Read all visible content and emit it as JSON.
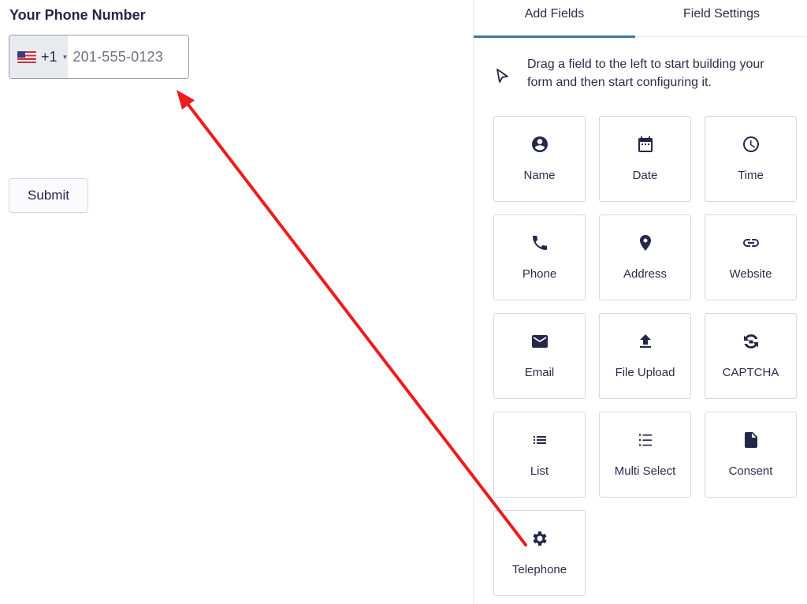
{
  "form": {
    "field_label": "Your Phone Number",
    "country_code": "+1",
    "phone_placeholder": "201-555-0123",
    "submit_label": "Submit"
  },
  "panel": {
    "tabs": [
      {
        "label": "Add Fields",
        "active": true
      },
      {
        "label": "Field Settings",
        "active": false
      }
    ],
    "hint": "Drag a field to the left to start building your form and then start configuring it.",
    "fields": [
      {
        "label": "Name",
        "icon": "account-circle-icon"
      },
      {
        "label": "Date",
        "icon": "calendar-icon"
      },
      {
        "label": "Time",
        "icon": "clock-icon"
      },
      {
        "label": "Phone",
        "icon": "phone-icon"
      },
      {
        "label": "Address",
        "icon": "map-pin-icon"
      },
      {
        "label": "Website",
        "icon": "link-icon"
      },
      {
        "label": "Email",
        "icon": "envelope-icon"
      },
      {
        "label": "File Upload",
        "icon": "upload-icon"
      },
      {
        "label": "CAPTCHA",
        "icon": "captcha-icon"
      },
      {
        "label": "List",
        "icon": "list-icon"
      },
      {
        "label": "Multi Select",
        "icon": "checklist-icon"
      },
      {
        "label": "Consent",
        "icon": "document-icon"
      },
      {
        "label": "Telephone",
        "icon": "gear-icon"
      }
    ]
  },
  "colors": {
    "accent": "#3e7aa0",
    "annotation_arrow": "#ee1c1c"
  }
}
